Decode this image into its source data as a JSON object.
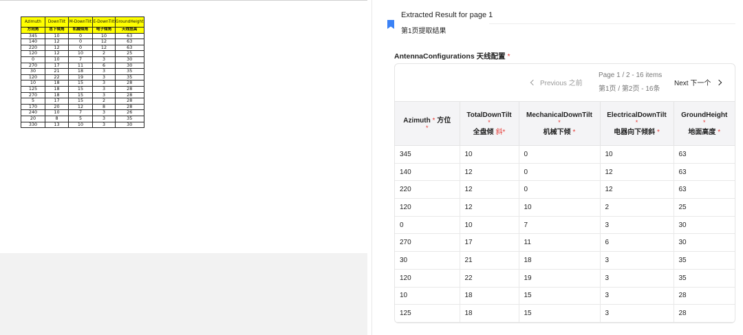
{
  "document": {
    "header_en": [
      "Azimuth",
      "DownTilt",
      "M-DownTilt",
      "E-DownTilt",
      "GroundHeight"
    ],
    "header_zh": [
      "方向角",
      "总下倾角",
      "机械倾角",
      "电子倾角",
      "天线挂高"
    ],
    "rows": [
      [
        "345",
        "10",
        "0",
        "10",
        "63"
      ],
      [
        "140",
        "12",
        "0",
        "12",
        "63"
      ],
      [
        "220",
        "12",
        "0",
        "12",
        "63"
      ],
      [
        "120",
        "12",
        "10",
        "2",
        "25"
      ],
      [
        "0",
        "10",
        "7",
        "3",
        "30"
      ],
      [
        "270",
        "17",
        "11",
        "6",
        "30"
      ],
      [
        "30",
        "21",
        "18",
        "3",
        "35"
      ],
      [
        "120",
        "22",
        "19",
        "3",
        "35"
      ],
      [
        "10",
        "18",
        "15",
        "3",
        "28"
      ],
      [
        "125",
        "18",
        "15",
        "3",
        "28"
      ],
      [
        "270",
        "18",
        "15",
        "3",
        "28"
      ],
      [
        "5",
        "17",
        "15",
        "2",
        "28"
      ],
      [
        "170",
        "20",
        "12",
        "8",
        "28"
      ],
      [
        "240",
        "10",
        "7",
        "3",
        "26"
      ],
      [
        "20",
        "8",
        "5",
        "3",
        "35"
      ],
      [
        "330",
        "13",
        "10",
        "3",
        "30"
      ]
    ]
  },
  "result": {
    "title": "Extracted Result for page 1",
    "subtitle": "第1页提取结果",
    "section": "AntennaConfigurations 天线配置",
    "required_mark": "*",
    "pager": {
      "prev_label": "Previous 之前",
      "info_en": "Page 1 / 2 - 16 items",
      "info_zh": "第1页 / 第2页 - 16条",
      "next_label": "Next 下一个"
    },
    "columns": [
      {
        "en": "Azimuth",
        "zh": "方位"
      },
      {
        "en": "TotalDownTilt",
        "zh": "全盘倾"
      },
      {
        "en": "MechanicalDownTilt",
        "zh": "机械下倾"
      },
      {
        "en": "ElectricalDownTilt",
        "zh": "电器向下倾斜"
      },
      {
        "en": "GroundHeight",
        "zh": "地面高度"
      }
    ],
    "col0_star_inline": "*",
    "col1_extra": "斜",
    "rows": [
      [
        "345",
        "10",
        "0",
        "10",
        "63"
      ],
      [
        "140",
        "12",
        "0",
        "12",
        "63"
      ],
      [
        "220",
        "12",
        "0",
        "12",
        "63"
      ],
      [
        "120",
        "12",
        "10",
        "2",
        "25"
      ],
      [
        "0",
        "10",
        "7",
        "3",
        "30"
      ],
      [
        "270",
        "17",
        "11",
        "6",
        "30"
      ],
      [
        "30",
        "21",
        "18",
        "3",
        "35"
      ],
      [
        "120",
        "22",
        "19",
        "3",
        "35"
      ],
      [
        "10",
        "18",
        "15",
        "3",
        "28"
      ],
      [
        "125",
        "18",
        "15",
        "3",
        "28"
      ]
    ]
  },
  "colors": {
    "accent": "#3b82f6",
    "required": "#e53935",
    "doc_header": "#ffff00"
  },
  "icons": {
    "bookmark": "bookmark-icon",
    "prev": "chevron-left-icon",
    "next": "chevron-right-icon"
  }
}
